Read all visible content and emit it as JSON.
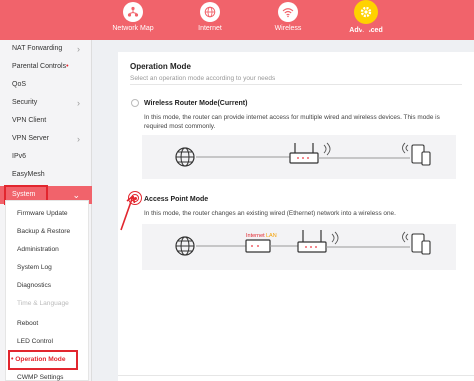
{
  "nav": {
    "items": [
      {
        "label": "Network Map",
        "icon": "network-map-icon"
      },
      {
        "label": "Internet",
        "icon": "globe-icon"
      },
      {
        "label": "Wireless",
        "icon": "wifi-icon"
      },
      {
        "label": "Advanced",
        "icon": "gear-icon",
        "active": true
      }
    ]
  },
  "sidebar": {
    "items": [
      {
        "label": "NAT Forwarding",
        "chevron": true
      },
      {
        "label": "Parental Controls",
        "dot": "•"
      },
      {
        "label": "QoS"
      },
      {
        "label": "Security",
        "chevron": true
      },
      {
        "label": "VPN Client"
      },
      {
        "label": "VPN Server",
        "chevron": true
      },
      {
        "label": "IPv6"
      },
      {
        "label": "EasyMesh"
      },
      {
        "label": "System",
        "chevron": true,
        "active": true
      }
    ],
    "submenu": [
      {
        "label": "Firmware Update"
      },
      {
        "label": "Backup & Restore"
      },
      {
        "label": "Administration"
      },
      {
        "label": "System Log"
      },
      {
        "label": "Diagnostics"
      },
      {
        "label": "Time & Language",
        "disabled": true
      },
      {
        "label": "Reboot"
      },
      {
        "label": "LED Control"
      },
      {
        "label": "Operation Mode",
        "selected": true,
        "dot": "•"
      },
      {
        "label": "CWMP Settings"
      }
    ]
  },
  "main": {
    "title": "Operation Mode",
    "subtitle": "Select an operation mode according to your needs",
    "options": [
      {
        "title": "Wireless Router Mode(Current)",
        "description": "In this mode, the router can provide internet access for multiple wired and wireless devices. This mode is required most commonly.",
        "selected": false
      },
      {
        "title": "Access Point Mode",
        "description": "In this mode, the router changes an existing wired (Ethernet) network into a wireless one.",
        "selected": true,
        "port_label_internet": "Internet",
        "port_label_lan": "LAN"
      }
    ]
  },
  "colors": {
    "accent": "#f1636b",
    "highlight": "#e2262e",
    "active_nav": "#ffd200"
  }
}
